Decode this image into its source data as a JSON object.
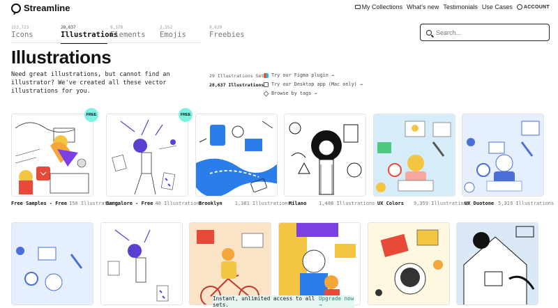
{
  "brand": {
    "name": "Streamline"
  },
  "topnav": {
    "my_collections": "My Collections",
    "whats_new": "What's new",
    "testimonials": "Testimonials",
    "use_cases": "Use Cases",
    "account": "ACCOUNT"
  },
  "tabs": [
    {
      "count": "153,723",
      "label": "Icons"
    },
    {
      "count": "28,637",
      "label": "Illustrations"
    },
    {
      "count": "6,378",
      "label": "Elements"
    },
    {
      "count": "2,352",
      "label": "Emojis"
    },
    {
      "count": "9,629",
      "label": "Freebies"
    }
  ],
  "search": {
    "placeholder": "Search..."
  },
  "page": {
    "title": "Illustrations",
    "description": "Need great illustrations, but cannot find an illustrator? We've created all these vector illustrations for you.",
    "sets_count": "29 Illustrations Sets",
    "total": "28,637 Illustrations"
  },
  "links": {
    "figma": "Try our Figma plugin →",
    "desktop": "Try our Desktop app (Mac only) →",
    "tags": "Browse by tags →"
  },
  "free_badge": "FREE",
  "sets": [
    {
      "name": "Free Samples - Free",
      "count": "150 Illustrations"
    },
    {
      "name": "Bangalore - Free",
      "count": "40 Illustrations"
    },
    {
      "name": "Brooklyn",
      "count": "1,381 Illustrations"
    },
    {
      "name": "Milano",
      "count": "1,488 Illustrations"
    },
    {
      "name": "UX Colors",
      "count": "9,359 Illustrations"
    },
    {
      "name": "UX Duotone",
      "count": "5,319 Illustrations"
    }
  ],
  "banner": {
    "text": "Instant, unlimited access to all sets.",
    "cta": "Upgrade now →"
  },
  "colors": {
    "badge": "#7ef2e0",
    "brooklyn_blue": "#2b7de9",
    "ux_yellow": "#f4c542",
    "duotone_blue": "#4a6fd8",
    "bangalore_purple": "#5a3fd1"
  }
}
